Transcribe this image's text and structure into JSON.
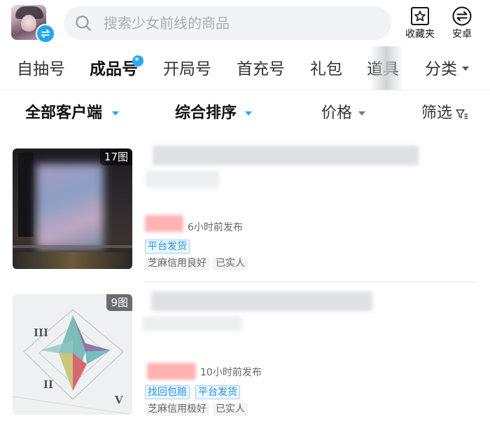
{
  "header": {
    "search_placeholder": "搜索少女前线的商品",
    "favorites_label": "收藏夹",
    "platform_label": "安卓"
  },
  "tabs": [
    {
      "label": "自抽号",
      "active": false
    },
    {
      "label": "成品号",
      "active": true,
      "has_dot": true
    },
    {
      "label": "开局号",
      "active": false
    },
    {
      "label": "首充号",
      "active": false
    },
    {
      "label": "礼包",
      "active": false
    },
    {
      "label": "道具",
      "active": false
    },
    {
      "label": "分类",
      "active": false,
      "dropdown": true
    }
  ],
  "filters": {
    "client": "全部客户端",
    "sort": "综合排序",
    "price": "价格",
    "screen": "筛选"
  },
  "listings": [
    {
      "image_count": "17图",
      "posted": "6小时前发布",
      "service_tags": [
        "平台发货"
      ],
      "credit_tags": [
        "芝麻信用良好",
        "已实人"
      ]
    },
    {
      "image_count": "9图",
      "posted": "10小时前发布",
      "service_tags": [
        "找回包赔",
        "平台发货"
      ],
      "credit_tags": [
        "芝麻信用极好",
        "已实人"
      ]
    }
  ],
  "colors": {
    "accent": "#2aa8f5",
    "tag_blue": "#1f8fe6",
    "price_blur": "#ffb3b3"
  }
}
